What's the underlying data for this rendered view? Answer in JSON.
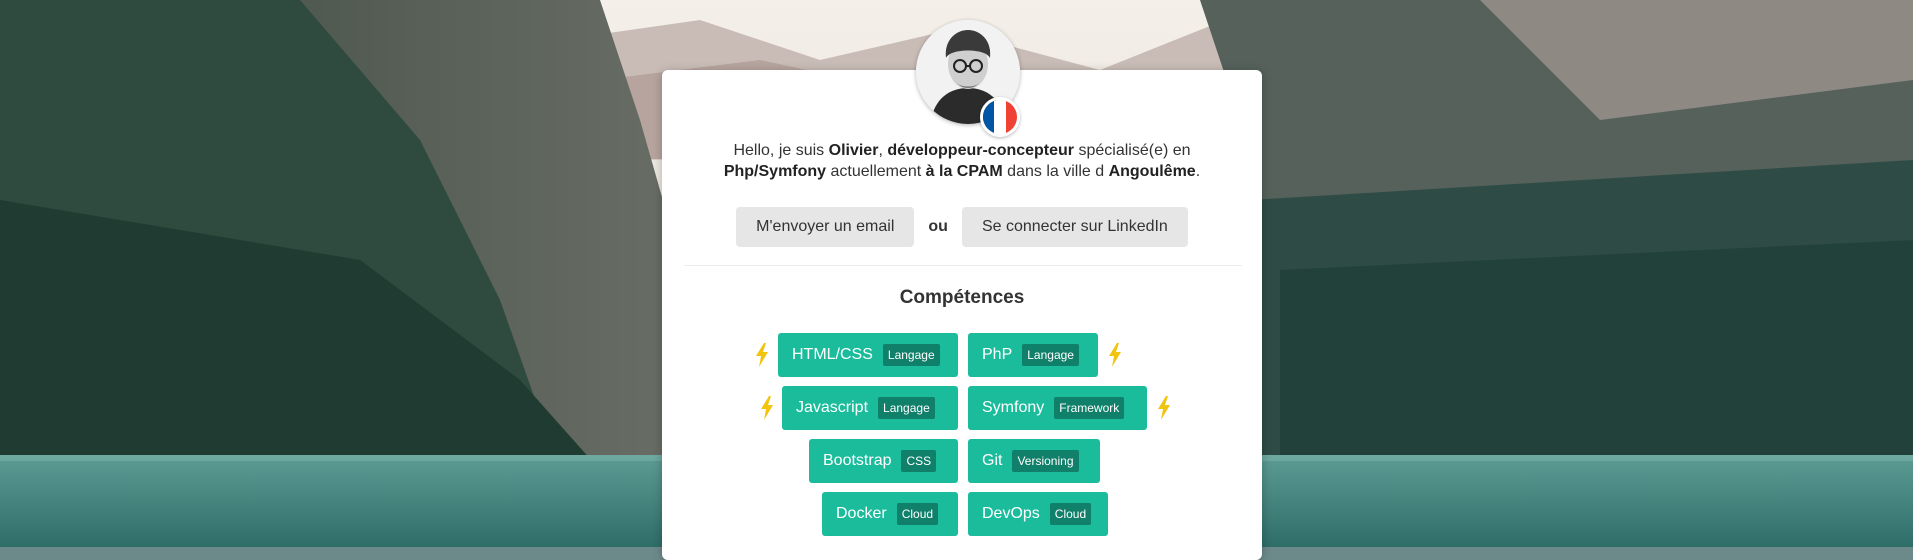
{
  "profile": {
    "intro_parts": [
      "Hello, je suis ",
      "Olivier",
      ", ",
      "développeur-concepteur",
      " spécialisé(e) en ",
      "Php/Symfony",
      " actuellement ",
      "à la CPAM",
      " dans la ville d ",
      "Angoulême",
      "."
    ],
    "avatar_icon": "avatar-photo",
    "flag_icon": "france-flag-icon",
    "flag_colors": [
      "#0055a4",
      "#ffffff",
      "#ef4135"
    ]
  },
  "actions": {
    "email_label": "M'envoyer un email",
    "or_label": "ou",
    "linkedin_label": "Se connecter sur LinkedIn"
  },
  "skills": {
    "title": "Compétences",
    "accent": "#1abc9c",
    "tag_color": "#10806a",
    "highlight_color": "#f1c40f",
    "items": [
      {
        "name": "HTML/CSS",
        "tag": "Langage",
        "highlighted": true
      },
      {
        "name": "PhP",
        "tag": "Langage",
        "highlighted": true
      },
      {
        "name": "Javascript",
        "tag": "Langage",
        "highlighted": true
      },
      {
        "name": "Symfony",
        "tag": "Framework",
        "highlighted": true
      },
      {
        "name": "Bootstrap",
        "tag": "CSS",
        "highlighted": false
      },
      {
        "name": "Git",
        "tag": "Versioning",
        "highlighted": false
      },
      {
        "name": "Docker",
        "tag": "Cloud",
        "highlighted": false
      },
      {
        "name": "DevOps",
        "tag": "Cloud",
        "highlighted": false
      }
    ]
  }
}
